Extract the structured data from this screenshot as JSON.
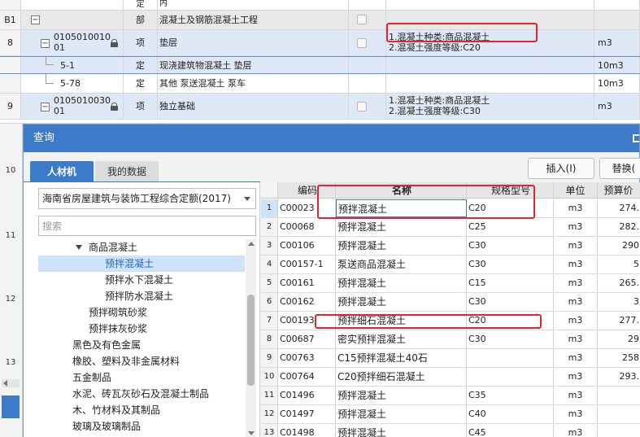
{
  "sheet": {
    "top_partial": "内",
    "rows": [
      {
        "num": "B1",
        "code": "",
        "cat": "部",
        "name": "混凝土及钢筋混凝土工程",
        "desc1": "",
        "desc2": "",
        "unit": ""
      },
      {
        "num": "8",
        "code1": "0105010010",
        "code2": "01",
        "cat": "项",
        "name": "垫层",
        "desc1": "1.混凝土种类:商品混凝土",
        "desc2": "2.混凝土强度等级:C20",
        "unit": "m3"
      },
      {
        "num": "",
        "code": "5-1",
        "cat": "定",
        "name": "现浇建筑物混凝土 垫层",
        "unit": "10m3"
      },
      {
        "num": "",
        "code": "5-78",
        "cat": "定",
        "name": "其他 泵送混凝土 泵车",
        "unit": "10m3"
      },
      {
        "num": "9",
        "code1": "0105010030",
        "code2": "01",
        "cat": "项",
        "name": "独立基础",
        "desc1": "1.混凝土种类:商品混凝土",
        "desc2": "2.混凝土强度等级:C30",
        "unit": "m3"
      }
    ],
    "left_rownums": [
      "10",
      "11",
      "12",
      "13"
    ]
  },
  "dialog": {
    "title": "查询",
    "tabs": [
      "人材机",
      "我的数据"
    ],
    "buttons": {
      "insert": "插入(I)",
      "replace": "替换("
    },
    "quota_select": "海南省房屋建筑与装饰工程综合定额(2017)",
    "search_placeholder": "搜索",
    "tree": [
      {
        "label": "商品混凝土",
        "level": 1,
        "expanded": true
      },
      {
        "label": "预拌混凝土",
        "level": 2,
        "selected": true
      },
      {
        "label": "预拌水下混凝土",
        "level": 2
      },
      {
        "label": "预拌防水混凝土",
        "level": 2
      },
      {
        "label": "预拌砌筑砂浆",
        "level": 1
      },
      {
        "label": "预拌抹灰砂浆",
        "level": 1
      },
      {
        "label": "黑色及有色金属",
        "level": 0
      },
      {
        "label": "橡胶、塑料及非金属材料",
        "level": 0
      },
      {
        "label": "五金制品",
        "level": 0
      },
      {
        "label": "水泥、砖瓦灰砂石及混凝土制品",
        "level": 0
      },
      {
        "label": "木、竹材料及其制品",
        "level": 0
      },
      {
        "label": "玻璃及玻璃制品",
        "level": 0
      }
    ],
    "grid": {
      "headers": [
        "编码",
        "名称",
        "规格型号",
        "单位",
        "预算价"
      ],
      "rows": [
        {
          "no": "1",
          "code": "C00023",
          "name": "预拌混凝土",
          "spec": "C20",
          "unit": "m3",
          "price": "274."
        },
        {
          "no": "2",
          "code": "C00068",
          "name": "预拌混凝土",
          "spec": "C25",
          "unit": "m3",
          "price": "282."
        },
        {
          "no": "3",
          "code": "C00106",
          "name": "预拌混凝土",
          "spec": "C30",
          "unit": "m3",
          "price": "290"
        },
        {
          "no": "4",
          "code": "C00157-1",
          "name": "泵送商品混凝土",
          "spec": "C30",
          "unit": "m3",
          "price": "5"
        },
        {
          "no": "5",
          "code": "C00161",
          "name": "预拌混凝土",
          "spec": "C15",
          "unit": "m3",
          "price": "265."
        },
        {
          "no": "6",
          "code": "C00162",
          "name": "预拌混凝土",
          "spec": "C30",
          "unit": "m3",
          "price": "3"
        },
        {
          "no": "7",
          "code": "C00193",
          "name": "预拌细石混凝土",
          "spec": "C20",
          "unit": "m3",
          "price": "277."
        },
        {
          "no": "8",
          "code": "C00687",
          "name": "密实预拌混凝土",
          "spec": "C30",
          "unit": "m3",
          "price": "29"
        },
        {
          "no": "9",
          "code": "C00763",
          "name": "C15预拌混凝土40石",
          "spec": "",
          "unit": "m3",
          "price": "258"
        },
        {
          "no": "10",
          "code": "C00764",
          "name": "C20预拌细石混凝土",
          "spec": "",
          "unit": "m3",
          "price": "293."
        },
        {
          "no": "11",
          "code": "C01496",
          "name": "预拌混凝土",
          "spec": "C35",
          "unit": "m3",
          "price": ""
        },
        {
          "no": "12",
          "code": "C01497",
          "name": "预拌混凝土",
          "spec": "C40",
          "unit": "m3",
          "price": ""
        },
        {
          "no": "13",
          "code": "C01498",
          "name": "预拌混凝土",
          "spec": "C45",
          "unit": "m3",
          "price": ""
        }
      ]
    }
  },
  "colors": {
    "accent": "#3c7bc8",
    "highlight_box": "#e8232a",
    "row_blue": "#dfe8f6"
  }
}
